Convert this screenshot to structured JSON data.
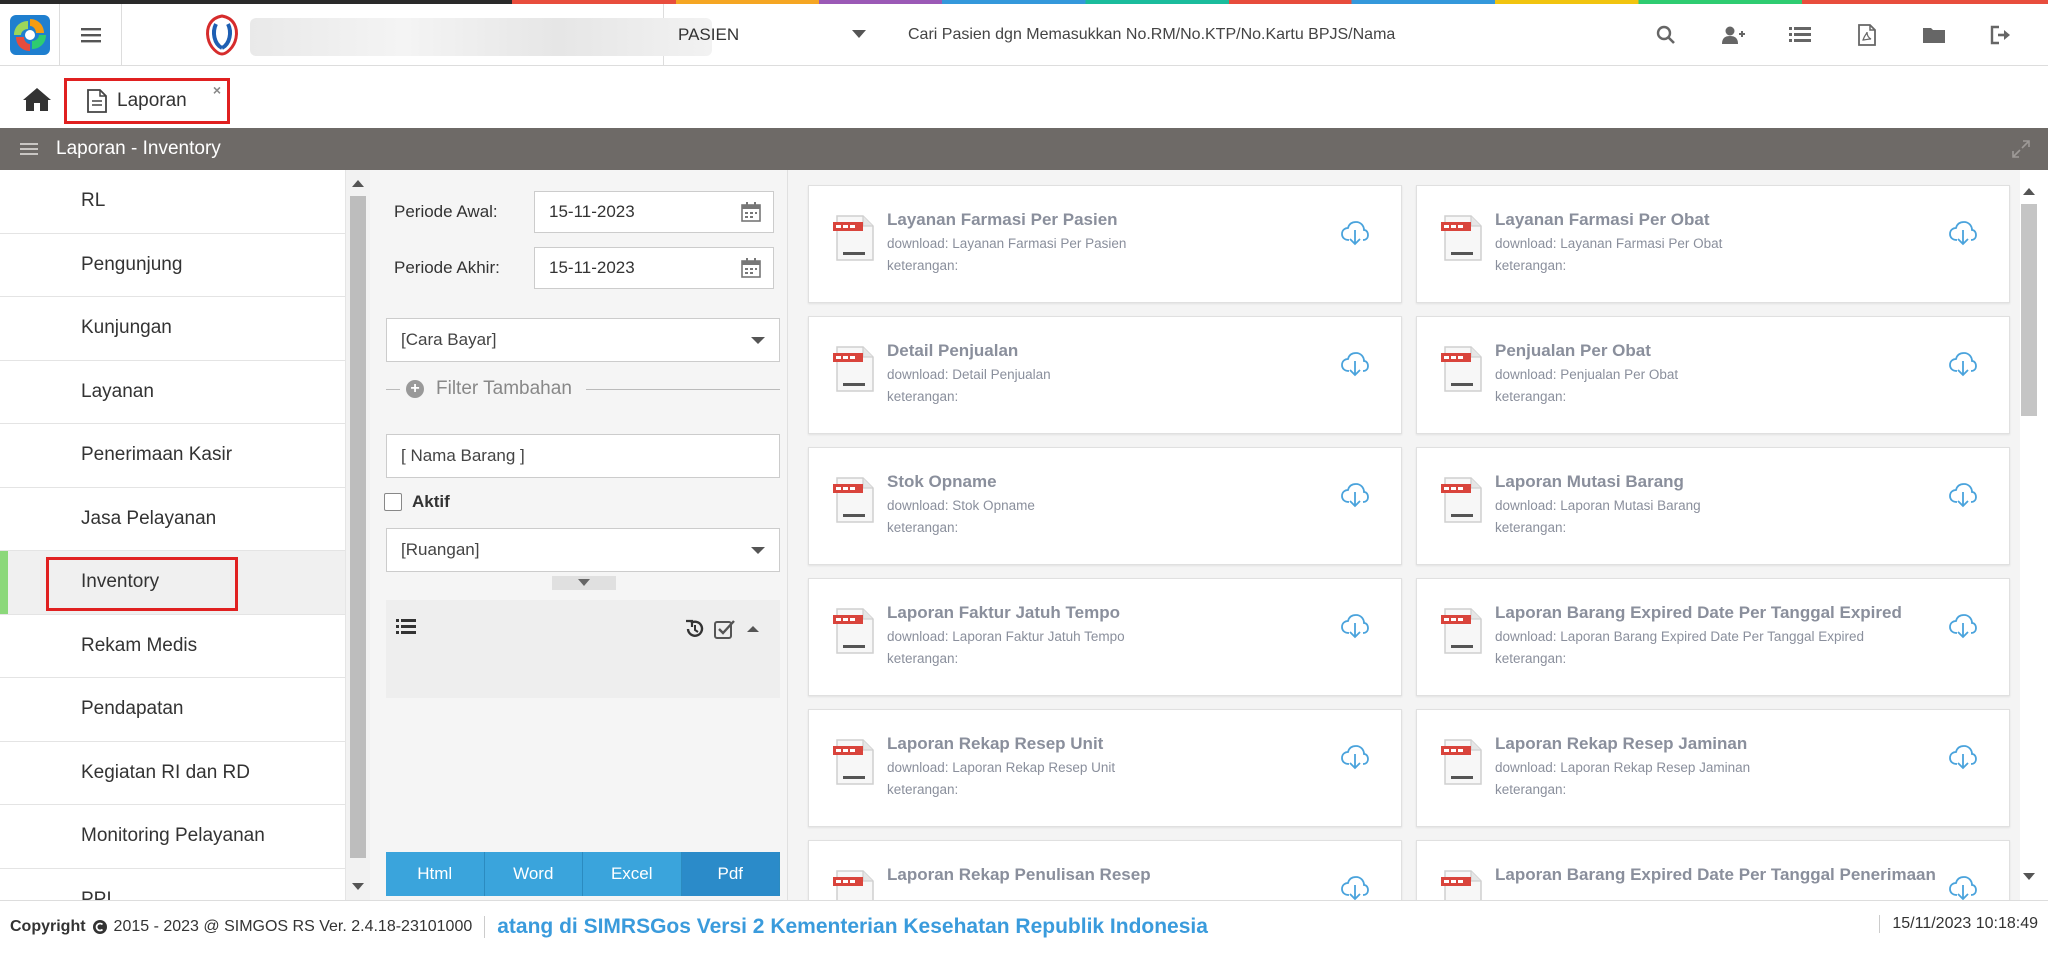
{
  "topbar": {
    "patient_select": "PASIEN",
    "search_placeholder": "Cari Pasien dgn Memasukkan No.RM/No.KTP/No.Kartu BPJS/Nama"
  },
  "tabs": {
    "active_label": "Laporan",
    "close": "×"
  },
  "section": {
    "title": "Laporan - Inventory"
  },
  "nav": {
    "items": [
      "RL",
      "Pengunjung",
      "Kunjungan",
      "Layanan",
      "Penerimaan Kasir",
      "Jasa Pelayanan",
      "Inventory",
      "Rekam Medis",
      "Pendapatan",
      "Kegiatan RI dan RD",
      "Monitoring Pelayanan",
      "PPI"
    ],
    "active": "Inventory"
  },
  "filters": {
    "periode_awal_label": "Periode Awal:",
    "periode_awal_value": "15-11-2023",
    "periode_akhir_label": "Periode Akhir:",
    "periode_akhir_value": "15-11-2023",
    "cara_bayar": "[Cara Bayar]",
    "filter_tambahan": "Filter Tambahan",
    "nama_barang_placeholder": "[ Nama Barang ]",
    "aktif_label": "Aktif",
    "ruangan": "[Ruangan]"
  },
  "export": {
    "buttons": [
      "Html",
      "Word",
      "Excel",
      "Pdf"
    ],
    "active": "Pdf"
  },
  "reports": [
    {
      "title": "Layanan Farmasi Per Pasien",
      "download": "download: Layanan Farmasi Per Pasien",
      "keterangan": "keterangan:"
    },
    {
      "title": "Layanan Farmasi Per Obat",
      "download": "download: Layanan Farmasi Per Obat",
      "keterangan": "keterangan:"
    },
    {
      "title": "Detail Penjualan",
      "download": "download: Detail Penjualan",
      "keterangan": "keterangan:"
    },
    {
      "title": "Penjualan Per Obat",
      "download": "download: Penjualan Per Obat",
      "keterangan": "keterangan:"
    },
    {
      "title": "Stok Opname",
      "download": "download: Stok Opname",
      "keterangan": "keterangan:"
    },
    {
      "title": "Laporan Mutasi Barang",
      "download": "download: Laporan Mutasi Barang",
      "keterangan": "keterangan:"
    },
    {
      "title": "Laporan Faktur Jatuh Tempo",
      "download": "download: Laporan Faktur Jatuh Tempo",
      "keterangan": "keterangan:"
    },
    {
      "title": "Laporan Barang Expired Date Per Tanggal Expired",
      "download": "download: Laporan Barang Expired Date Per Tanggal Expired",
      "keterangan": "keterangan:"
    },
    {
      "title": "Laporan Rekap Resep Unit",
      "download": "download: Laporan Rekap Resep Unit",
      "keterangan": "keterangan:"
    },
    {
      "title": "Laporan Rekap Resep Jaminan",
      "download": "download: Laporan Rekap Resep Jaminan",
      "keterangan": "keterangan:"
    },
    {
      "title": "Laporan Rekap Penulisan Resep",
      "download": "",
      "keterangan": ""
    },
    {
      "title": "Laporan Barang Expired Date Per Tanggal Penerimaan",
      "download": "",
      "keterangan": ""
    }
  ],
  "footer": {
    "copyright_label": "Copyright",
    "copyright_text": "2015 - 2023 @ SIMGOS RS Ver. 2.4.18-23101000",
    "marquee": "atang di SIMRSGos Versi 2 Kementerian Kesehatan Republik Indonesia",
    "datetime": "15/11/2023 10:18:49"
  },
  "colors": {
    "accent": "#3aa4dc",
    "header_bg": "#6e6a67",
    "highlight_red": "#e02020",
    "active_green": "#8bd87a"
  }
}
